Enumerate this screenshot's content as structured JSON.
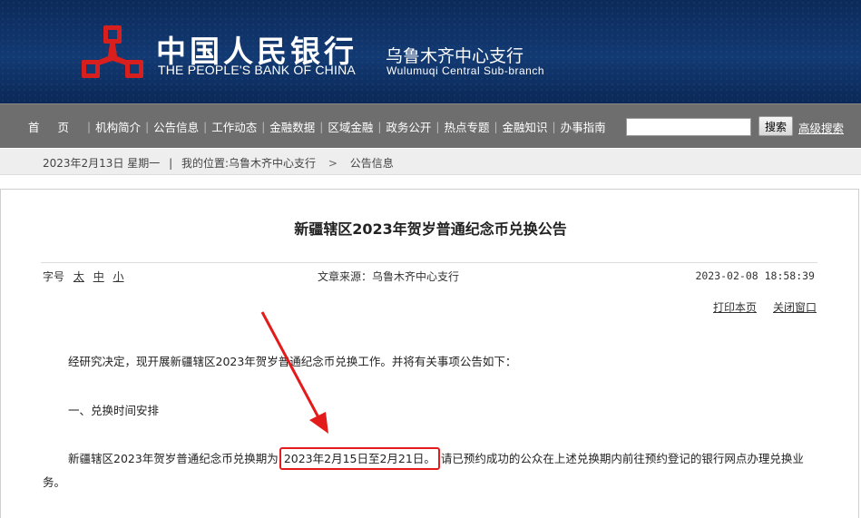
{
  "header": {
    "brand_cn": "中国人民银行",
    "brand_en": "THE PEOPLE'S BANK OF CHINA",
    "branch_cn": "乌鲁木齐中心支行",
    "branch_en": "Wulumuqi  Central  Sub-branch",
    "logo_icon": "pboc-logo-icon",
    "logo_color": "#d7201d"
  },
  "nav": {
    "items": [
      "首页",
      "机构简介",
      "公告信息",
      "工作动态",
      "金融数据",
      "区域金融",
      "政务公开",
      "热点专题",
      "金融知识",
      "办事指南"
    ],
    "search_placeholder": "",
    "search_button": "搜索",
    "advanced_search": "高级搜索"
  },
  "breadcrumb": {
    "date": "2023年2月13日 星期一",
    "sep": "|",
    "prefix": "我的位置:",
    "branch": "乌鲁木齐中心支行",
    "arrow": ">",
    "section": "公告信息"
  },
  "article": {
    "title": "新疆辖区2023年贺岁普通纪念币兑换公告",
    "fontsize_label": "字号",
    "fontsize_large": "太",
    "fontsize_medium": "中",
    "fontsize_small": "小",
    "source": "文章来源：乌鲁木齐中心支行",
    "published": "2023-02-08 18:58:39",
    "print": "打印本页",
    "close": "关闭窗口",
    "para1": "经研究决定，现开展新疆辖区2023年贺岁普通纪念币兑换工作。并将有关事项公告如下：",
    "para2": "一、兑换时间安排",
    "para3_pre": "新疆辖区2023年贺岁普通纪念币兑换期为",
    "para3_highlight": "2023年2月15日至2月21日。",
    "para3_post": "请已预约成功的公众在上述兑换期内前往预约登记的银行网点办理兑换业务。"
  },
  "annotation": {
    "color": "#e31b1b"
  }
}
